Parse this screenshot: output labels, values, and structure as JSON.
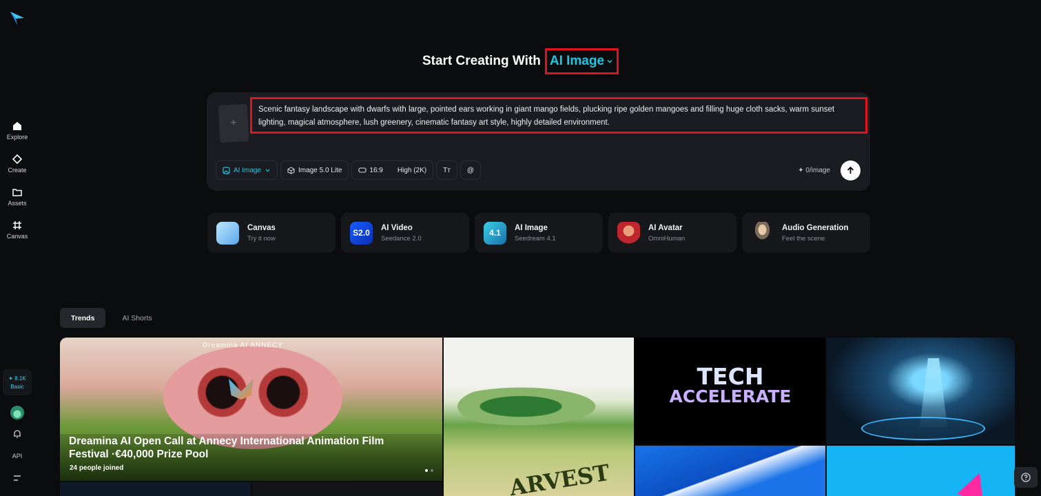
{
  "sidebar": {
    "items": [
      {
        "label": "Explore",
        "icon": "home-icon"
      },
      {
        "label": "Create",
        "icon": "diamond-icon"
      },
      {
        "label": "Assets",
        "icon": "folder-icon"
      },
      {
        "label": "Canvas",
        "icon": "canvas-grid-icon"
      }
    ],
    "credits": {
      "value": "8.1K",
      "plan": "Basic"
    },
    "api_label": "API"
  },
  "headline": {
    "prefix": "Start Creating With",
    "mode": "AI Image"
  },
  "composer": {
    "prompt": "Scenic fantasy landscape with dwarfs with large, pointed ears working in giant mango fields, plucking ripe golden mangoes and filling huge cloth sacks, warm sunset lighting, magical atmosphere, lush greenery, cinematic fantasy art style, highly detailed environment.",
    "upload_symbol": "+",
    "tools": {
      "mode": "AI Image",
      "model": "Image 5.0 Lite",
      "ratio": "16:9",
      "quality": "High (2K)",
      "text_tool": "Tт",
      "mention": "@"
    },
    "cost": "0/image"
  },
  "cards": [
    {
      "title": "Canvas",
      "subtitle": "Try it now"
    },
    {
      "title": "AI Video",
      "subtitle": "Seedance 2.0",
      "badge": "S2.0"
    },
    {
      "title": "AI Image",
      "subtitle": "Seedream 4.1",
      "badge": "4.1"
    },
    {
      "title": "AI Avatar",
      "subtitle": "OmniHuman"
    },
    {
      "title": "Audio Generation",
      "subtitle": "Feel the scene"
    }
  ],
  "tabs": [
    "Trends",
    "AI Shorts"
  ],
  "feature": {
    "brand": "Dreamina AI  ANNECY",
    "title": "Dreamina AI Open Call at Annecy International Animation Film Festival ·€40,000 Prize Pool",
    "joined": "24  people joined"
  },
  "tiles": {
    "harvest_text": "ARVEST",
    "tech_line1": "TECH",
    "tech_line2": "ACCELERATE"
  },
  "colors": {
    "accent": "#1fc6e0",
    "highlight_box": "#e0141e",
    "background": "#0b0c0e"
  }
}
